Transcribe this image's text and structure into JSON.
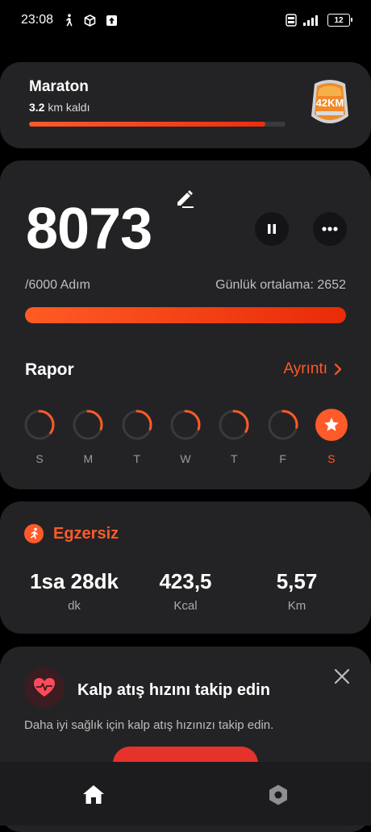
{
  "status_bar": {
    "time": "23:08",
    "battery": "12",
    "icons": [
      "walk-icon",
      "box-icon",
      "upload-icon",
      "volte-icon",
      "signal-icon",
      "battery-icon"
    ]
  },
  "maraton": {
    "title": "Maraton",
    "remaining_value": "3.2",
    "remaining_text": " km kaldı",
    "progress_fraction": 0.92,
    "medal_text": "42KM"
  },
  "steps": {
    "count": "8073",
    "goal": "/6000 Adım",
    "average": "Günlük ortalama: 2652",
    "progress_fraction": 1.0
  },
  "report": {
    "title": "Rapor",
    "details_link": "Ayrıntı",
    "days": [
      {
        "label": "S",
        "fraction": 0.35
      },
      {
        "label": "M",
        "fraction": 0.3
      },
      {
        "label": "T",
        "fraction": 0.3
      },
      {
        "label": "W",
        "fraction": 0.3
      },
      {
        "label": "T",
        "fraction": 0.33
      },
      {
        "label": "F",
        "fraction": 0.28
      },
      {
        "label": "S",
        "fraction": 1.0,
        "completed": true
      }
    ]
  },
  "exercise": {
    "title": "Egzersiz",
    "duration_value": "1sa 28dk",
    "duration_unit": "dk",
    "calories_value": "423,5",
    "calories_unit": "Kcal",
    "distance_value": "5,57",
    "distance_unit": "Km"
  },
  "heart": {
    "title": "Kalp atış hızını takip edin",
    "description": "Daha iyi sağlık için kalp atış hızınızı takip edin."
  },
  "colors": {
    "accent": "#ff5a2a",
    "card_bg": "#232325",
    "heart_bg": "#3a1d20",
    "cta": "#e5322b"
  }
}
